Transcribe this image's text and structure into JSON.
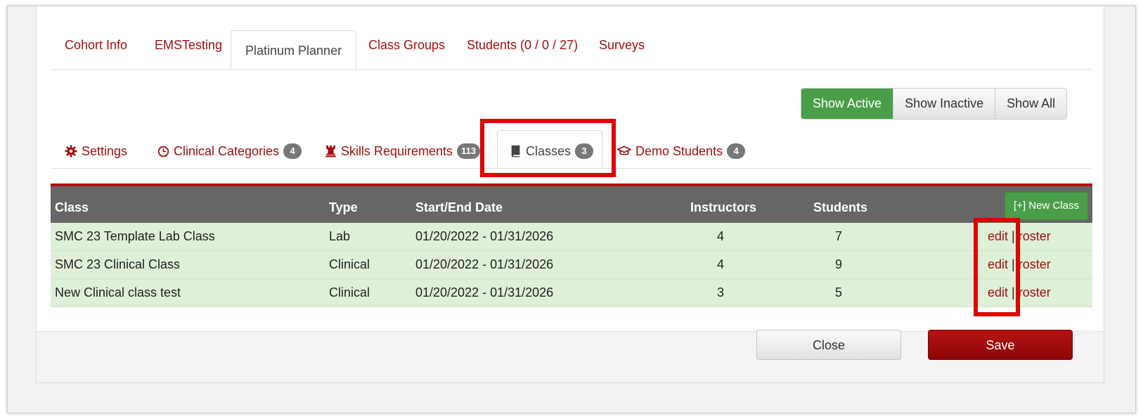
{
  "top_tabs": [
    {
      "label": "Cohort Info",
      "active": false
    },
    {
      "label": "EMSTesting",
      "active": false
    },
    {
      "label": "Platinum Planner",
      "active": true
    },
    {
      "label": "Class Groups",
      "active": false
    },
    {
      "label": "Students (0 / 0 / 27)",
      "active": false
    },
    {
      "label": "Surveys",
      "active": false
    }
  ],
  "filter_buttons": [
    {
      "label": "Show Active",
      "active": true
    },
    {
      "label": "Show Inactive",
      "active": false
    },
    {
      "label": "Show All",
      "active": false
    }
  ],
  "sub_tabs": [
    {
      "label": "Settings",
      "icon": "gear-icon",
      "badge": null
    },
    {
      "label": "Clinical Categories",
      "icon": "clock-icon",
      "badge": "4"
    },
    {
      "label": "Skills Requirements",
      "icon": "chess-rook-icon",
      "badge": "113"
    },
    {
      "label": "Classes",
      "icon": "book-icon",
      "badge": "3",
      "active": true
    },
    {
      "label": "Demo Students",
      "icon": "graduation-cap-icon",
      "badge": "4"
    }
  ],
  "table": {
    "headers": {
      "class": "Class",
      "type": "Type",
      "dates": "Start/End Date",
      "instructors": "Instructors",
      "students": "Students"
    },
    "new_class_label": "[+] New Class",
    "rows": [
      {
        "class": "SMC 23 Template Lab Class",
        "type": "Lab",
        "dates": "01/20/2022 - 01/31/2026",
        "instructors": "4",
        "students": "7",
        "edit": "edit",
        "sep": "|",
        "roster": "roster"
      },
      {
        "class": "SMC 23 Clinical Class",
        "type": "Clinical",
        "dates": "01/20/2022 - 01/31/2026",
        "instructors": "4",
        "students": "9",
        "edit": "edit",
        "sep": "|",
        "roster": "roster"
      },
      {
        "class": "New Clinical class test",
        "type": "Clinical",
        "dates": "01/20/2022 - 01/31/2026",
        "instructors": "3",
        "students": "5",
        "edit": "edit",
        "sep": "|",
        "roster": "roster"
      }
    ]
  },
  "footer": {
    "close_label": "Close",
    "save_label": "Save"
  },
  "colors": {
    "brand_red": "#a30f0f",
    "active_green": "#4a9e4a",
    "highlight_red": "#e00000",
    "row_green": "#dff0d8"
  }
}
